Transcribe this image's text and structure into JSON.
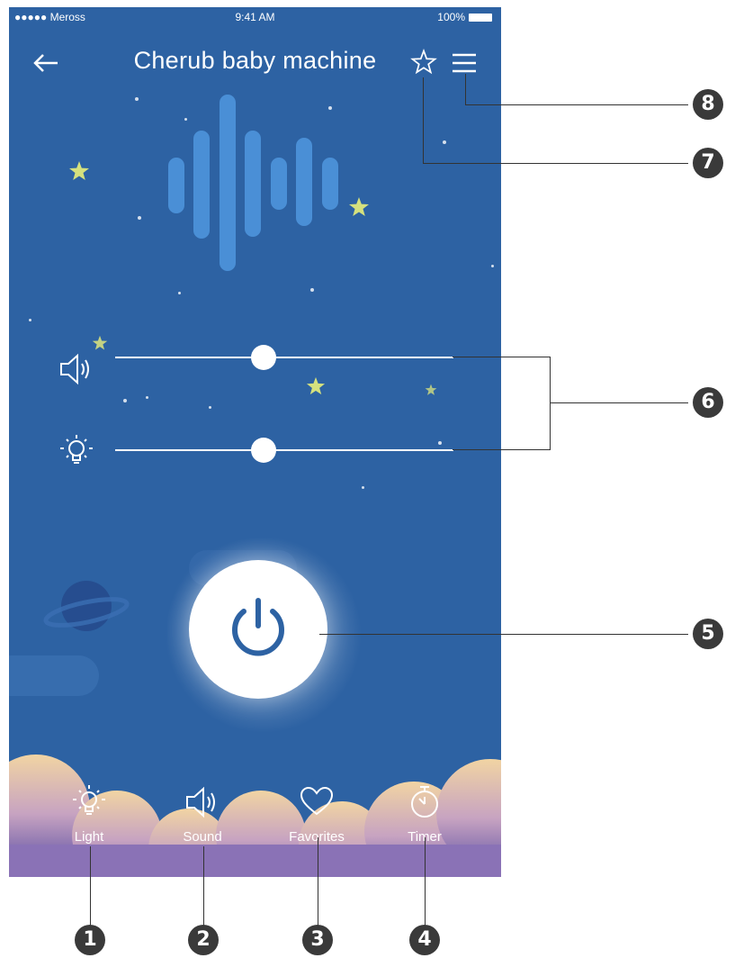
{
  "status_bar": {
    "carrier": "●●●●● Meross",
    "time": "9:41 AM",
    "battery": "100%"
  },
  "header": {
    "title": "Cherub baby machine",
    "back_icon": "arrow-left-icon",
    "favorite_icon": "star-outline-icon",
    "menu_icon": "hamburger-menu-icon"
  },
  "sliders": {
    "volume_level": 0.44,
    "brightness_level": 0.44
  },
  "nav": {
    "items": [
      {
        "label": "Light",
        "icon": "lightbulb-icon"
      },
      {
        "label": "Sound",
        "icon": "speaker-icon"
      },
      {
        "label": "Favorites",
        "icon": "heart-icon"
      },
      {
        "label": "Timer",
        "icon": "stopwatch-icon"
      }
    ]
  },
  "callouts": [
    "8",
    "7",
    "6",
    "5",
    "1",
    "2",
    "3",
    "4"
  ],
  "colors": {
    "background": "#2d62a3",
    "wave": "#4a8fd6",
    "accent": "#2d62a3",
    "star": "#e8ef7a"
  }
}
